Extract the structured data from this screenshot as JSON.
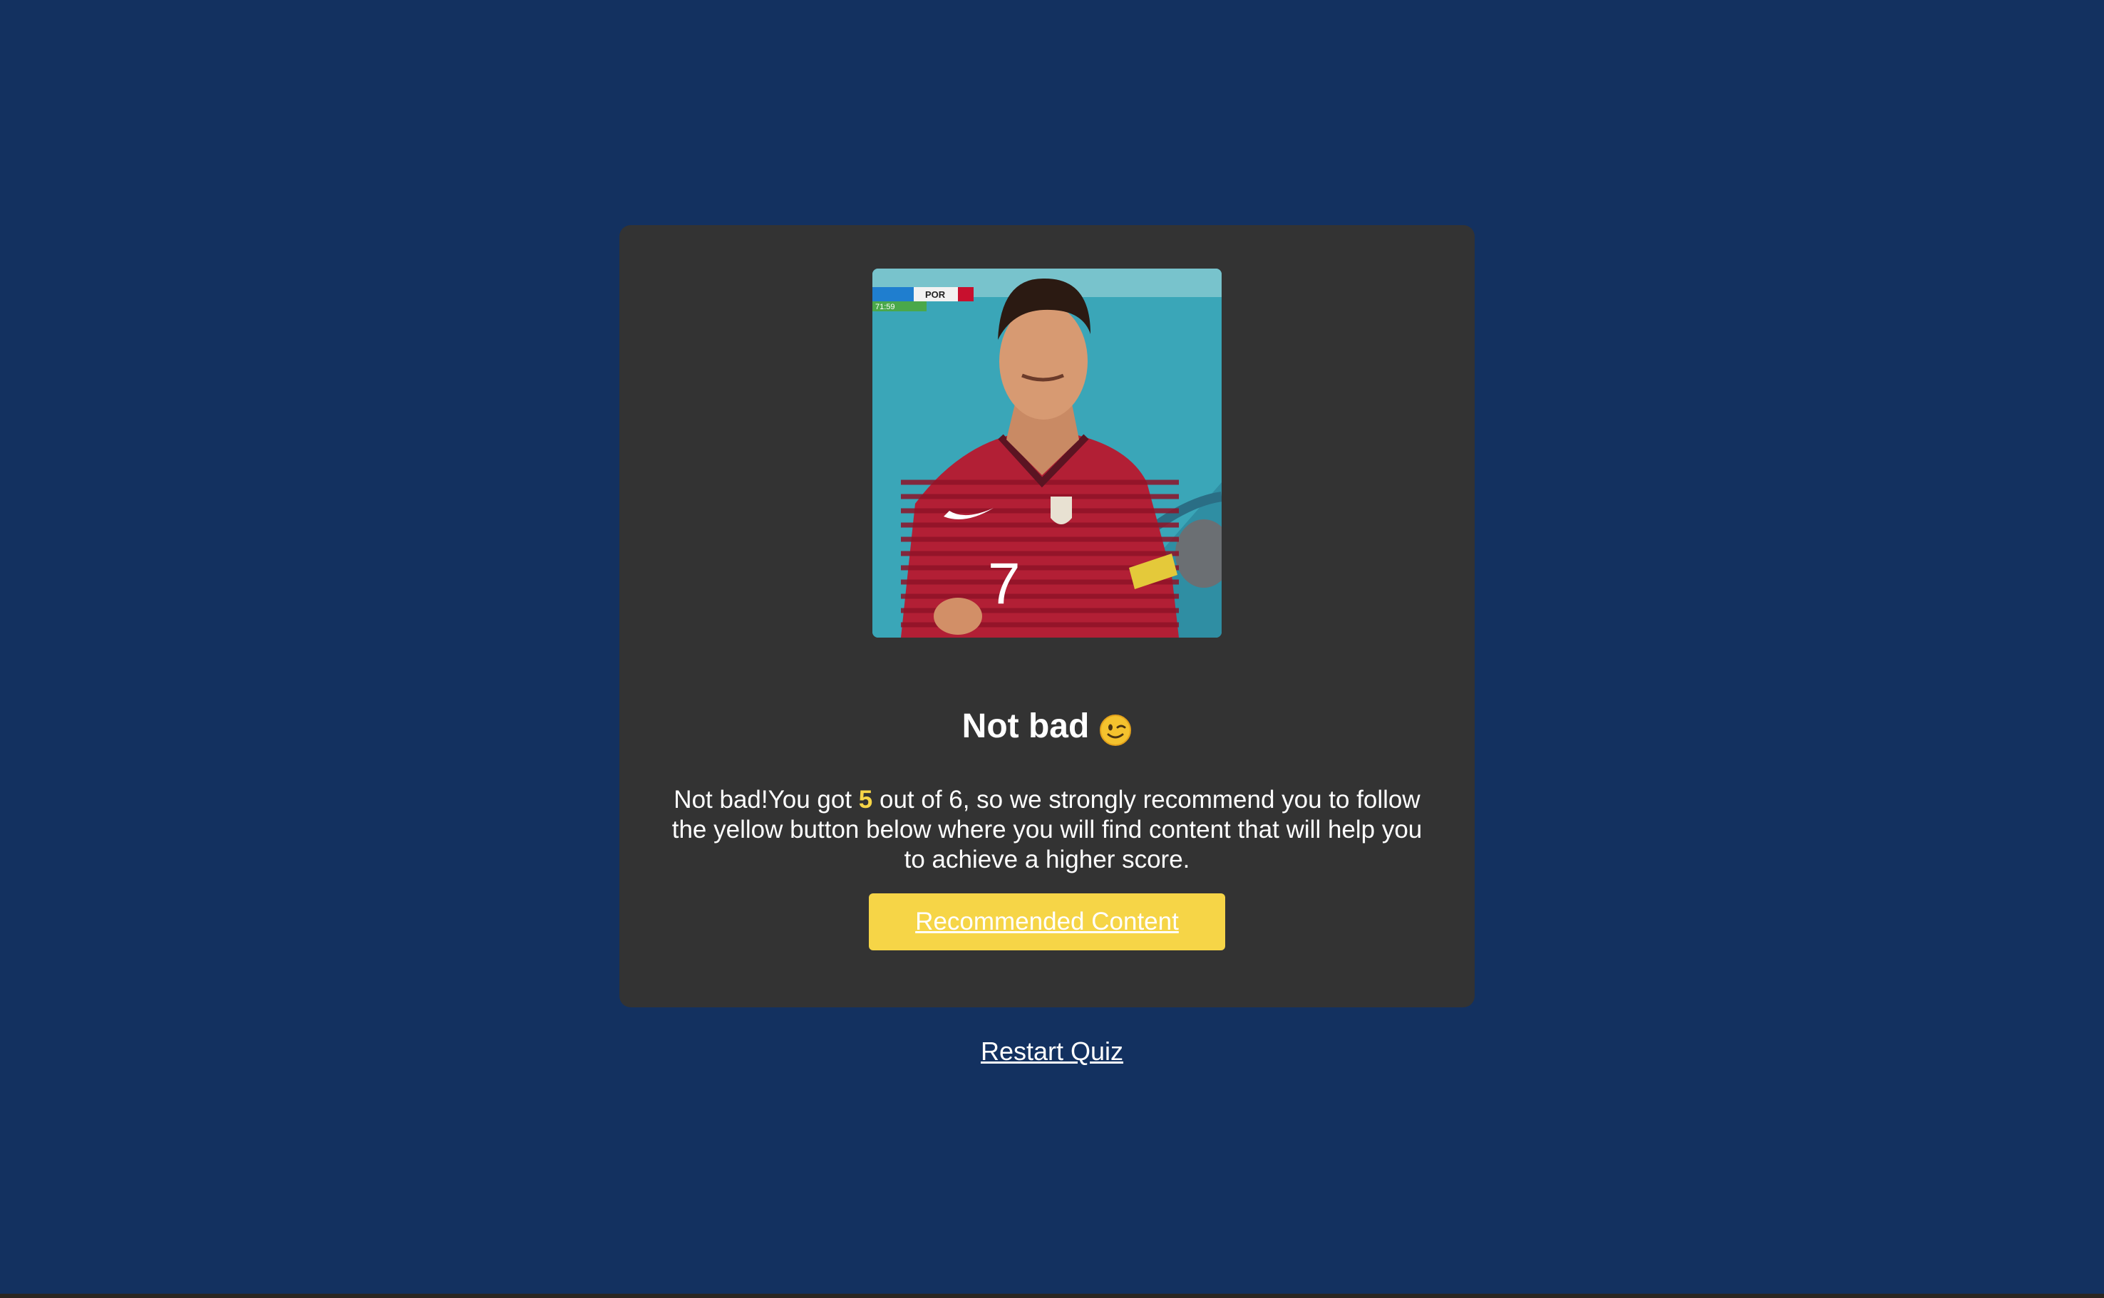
{
  "result": {
    "title": "Not bad",
    "emoji_icon": "winking-face-icon",
    "message_prefix": "Not bad!You got ",
    "score": "5",
    "message_suffix": " out of 6, so we strongly recommend you to follow the yellow button below where you will find content that will help you to achieve a higher score.",
    "cta_label": "Recommended Content"
  },
  "photo": {
    "scoreboard_team": "POR",
    "scoreboard_time": "71:59",
    "jersey_number": "7"
  },
  "footer": {
    "restart_label": "Restart Quiz"
  },
  "colors": {
    "background": "#133160",
    "card": "#333333",
    "accent": "#f6d547"
  }
}
